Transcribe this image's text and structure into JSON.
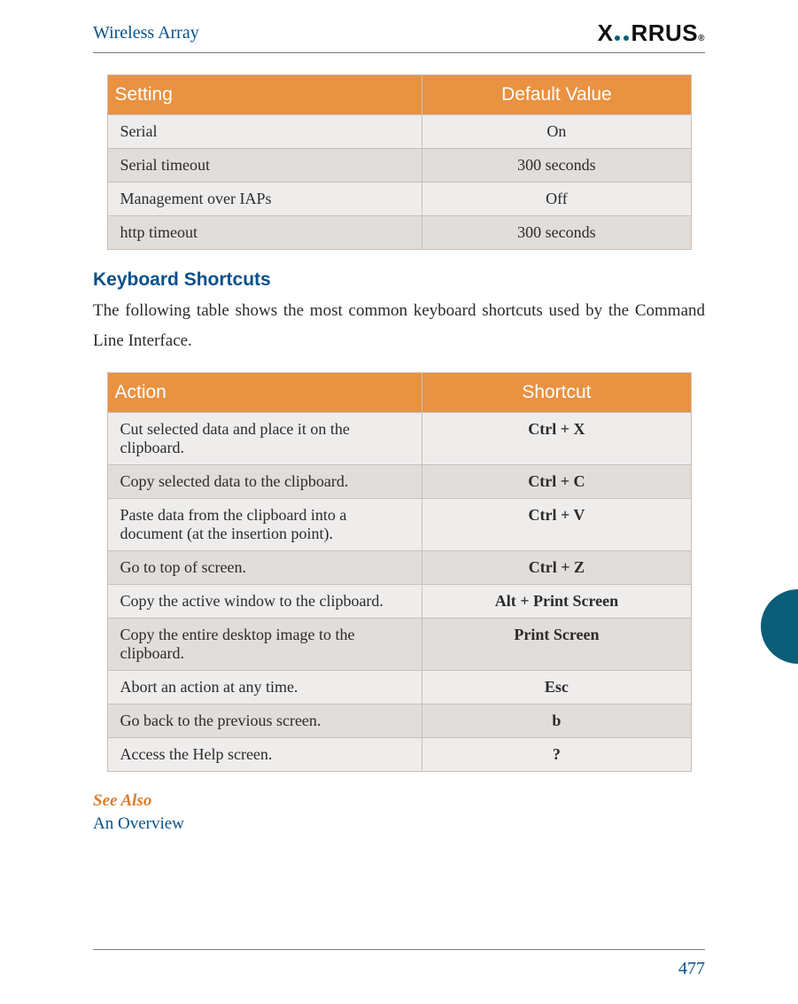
{
  "header": {
    "running_head": "Wireless Array"
  },
  "logo": {
    "x": "X",
    "rrus": "RRUS",
    "reg": "®"
  },
  "table1": {
    "headers": {
      "a": "Setting",
      "b": "Default Value"
    },
    "rows": [
      {
        "a": "Serial",
        "b": "On"
      },
      {
        "a": "Serial timeout",
        "b": "300 seconds"
      },
      {
        "a": "Management over IAPs",
        "b": "Off"
      },
      {
        "a": "http timeout",
        "b": "300 seconds"
      }
    ]
  },
  "section_title": "Keyboard Shortcuts",
  "intro": "The following table shows the most common keyboard shortcuts used by the Command Line Interface.",
  "table2": {
    "headers": {
      "a": "Action",
      "b": "Shortcut"
    },
    "rows": [
      {
        "a": "Cut selected data and place it on the clipboard.",
        "b": "Ctrl + X"
      },
      {
        "a": "Copy selected data to the clipboard.",
        "b": "Ctrl + C"
      },
      {
        "a": "Paste data from the clipboard into a document (at the insertion point).",
        "b": "Ctrl + V"
      },
      {
        "a": "Go to top of screen.",
        "b": "Ctrl + Z"
      },
      {
        "a": "Copy the active window to the clipboard.",
        "b": "Alt + Print Screen"
      },
      {
        "a": "Copy the entire desktop image to the clipboard.",
        "b": "Print Screen"
      },
      {
        "a": "Abort an action at any time.",
        "b": "Esc"
      },
      {
        "a": "Go back to the previous screen.",
        "b": "b"
      },
      {
        "a": "Access the Help screen.",
        "b": "?"
      }
    ]
  },
  "see_also": {
    "label": "See Also",
    "link": "An Overview"
  },
  "page_number": "477"
}
